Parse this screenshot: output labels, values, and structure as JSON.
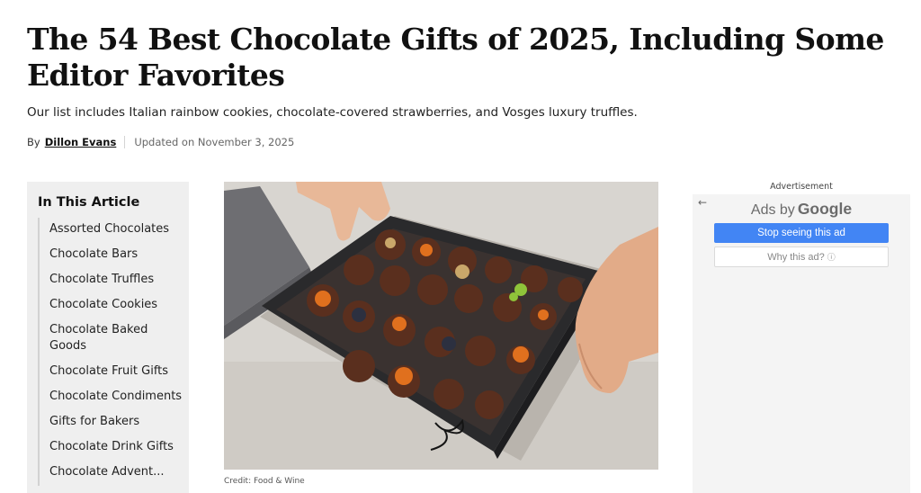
{
  "article": {
    "title": "The 54 Best Chocolate Gifts of 2025, Including Some Editor Favorites",
    "subtitle": "Our list includes Italian rainbow cookies, chocolate-covered strawberries, and Vosges luxury truffles.",
    "byline": {
      "by": "By",
      "author": "Dillon Evans",
      "updated": "Updated on November 3, 2025"
    }
  },
  "toc": {
    "heading": "In This Article",
    "items": [
      "Assorted Chocolates",
      "Chocolate Bars",
      "Chocolate Truffles",
      "Chocolate Cookies",
      "Chocolate Baked Goods",
      "Chocolate Fruit Gifts",
      "Chocolate Condiments",
      "Gifts for Bakers",
      "Chocolate Drink Gifts",
      "Chocolate Advent..."
    ]
  },
  "photo": {
    "credit": "Credit: Food & Wine"
  },
  "ad": {
    "label": "Advertisement",
    "back_icon": "back-arrow-icon",
    "ads_by": "Ads by",
    "google": "Google",
    "stop_label": "Stop seeing this ad",
    "why_label": "Why this ad?",
    "info_icon": "info-icon",
    "button_color": "#4285f4"
  }
}
